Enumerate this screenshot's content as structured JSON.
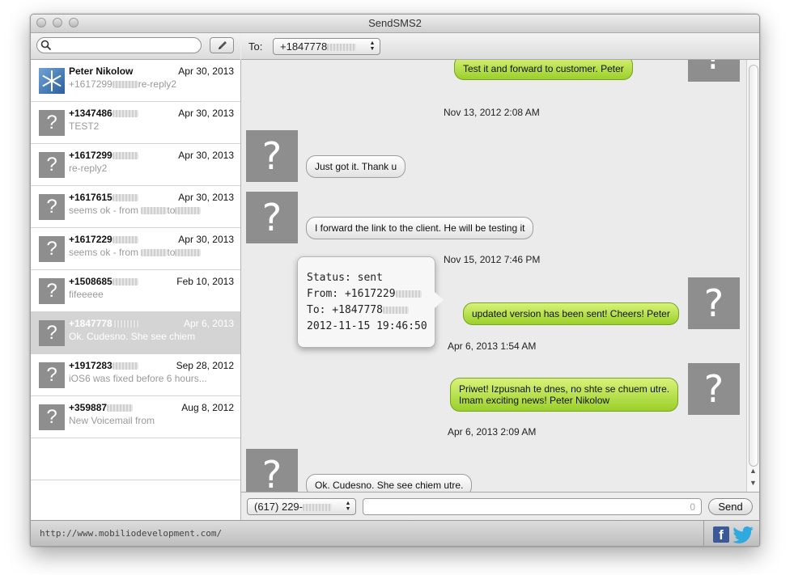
{
  "window": {
    "title": "SendSMS2"
  },
  "search": {
    "placeholder": ""
  },
  "conversations": [
    {
      "name": "Peter Nikolow",
      "date": "Apr 30, 2013",
      "preview_pre": "+1617299",
      "preview_post": "re-reply2",
      "avatar": "photo",
      "selected": false
    },
    {
      "name": "+1347486",
      "date": "Apr 30, 2013",
      "preview": "TEST2",
      "avatar": "?",
      "selected": false
    },
    {
      "name": "+1617299",
      "date": "Apr 30, 2013",
      "preview": "re-reply2",
      "avatar": "?",
      "selected": false
    },
    {
      "name": "+1617615",
      "date": "Apr 30, 2013",
      "preview_pre": "seems ok - from",
      "preview_mid": "to",
      "avatar": "?",
      "selected": false
    },
    {
      "name": "+1617229",
      "date": "Apr 30, 2013",
      "preview_pre": "seems ok - from",
      "preview_mid": "to",
      "avatar": "?",
      "selected": false
    },
    {
      "name": "+1508685",
      "date": "Feb 10, 2013",
      "preview": "fifeeeee",
      "avatar": "?",
      "selected": false
    },
    {
      "name": "+1847778",
      "date": "Apr 6, 2013",
      "preview": "Ok. Cudesno. She see chiem",
      "avatar": "?",
      "selected": true
    },
    {
      "name": "+1917283",
      "date": "Sep 28, 2012",
      "preview": "iOS6 was fixed before 6 hours...",
      "avatar": "?",
      "selected": false
    },
    {
      "name": "+359887",
      "date": "Aug 8, 2012",
      "preview": "New Voicemail from",
      "avatar": "?",
      "selected": false
    }
  ],
  "to_bar": {
    "label": "To:",
    "recipient": "+1847778"
  },
  "messages": {
    "top_partial": "Test it and forward to customer. Peter",
    "ts1": "Nov 13, 2012 2:08 AM",
    "m1": "Just got it. Thank u",
    "m2": "I forward the link to the client. He will be testing it",
    "ts2": "Nov 15, 2012 7:46 PM",
    "m3": "updated version has been sent! Cheers! Peter",
    "ts3": "Apr 6, 2013 1:54 AM",
    "m4_line1": "Priwet! Izpusnah te dnes, no shte se chuem utre.",
    "m4_line2": "Imam exciting news! Peter Nikolow",
    "ts4": "Apr 6, 2013 2:09 AM",
    "m5": "Ok. Cudesno. She see chiem utre."
  },
  "tooltip": {
    "status": "Status: sent",
    "from": "From: +1617229",
    "to": "To: +1847778",
    "datetime": "2012-11-15 19:46:50"
  },
  "composer": {
    "sender": "(617) 229-",
    "char_count": "0",
    "send_label": "Send"
  },
  "statusbar": {
    "url": "http://www.mobiliodevelopment.com/"
  },
  "avatar_glyph": "?",
  "colors": {
    "bubble_out": "#a9d843",
    "bubble_in": "#f4f4f4",
    "avatar_bg": "#8e8e8e",
    "facebook": "#3b5998",
    "twitter": "#2fa9e0"
  }
}
